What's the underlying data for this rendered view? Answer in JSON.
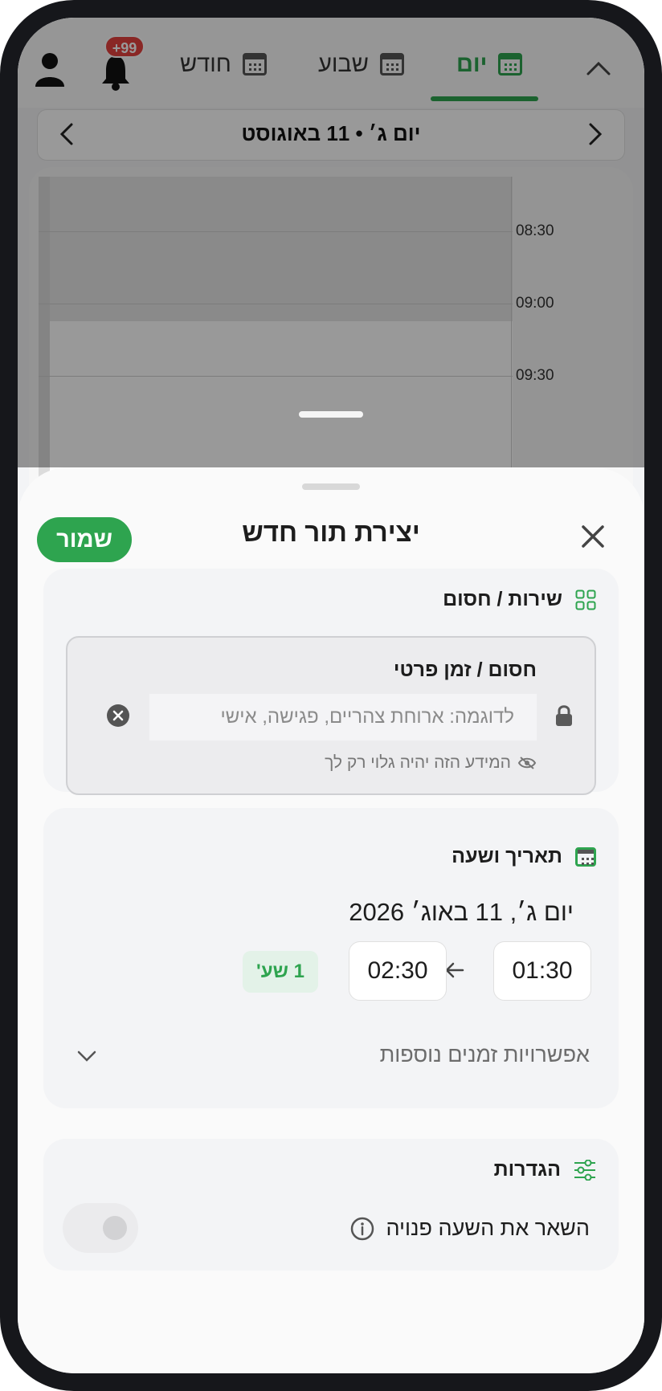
{
  "nav": {
    "tabs": [
      {
        "label": "יום",
        "active": true
      },
      {
        "label": "שבוע",
        "active": false
      },
      {
        "label": "חודש",
        "active": false
      }
    ],
    "notification_badge": "+99"
  },
  "day_header": {
    "title": "יום ג׳ • 11 באוגוסט"
  },
  "calendar": {
    "times": [
      "08:30",
      "09:00",
      "09:30"
    ]
  },
  "sheet": {
    "title": "יצירת תור חדש",
    "save_label": "שמור",
    "service_section": {
      "heading": "שירות / חסום",
      "block_title": "חסום / זמן פרטי",
      "input_placeholder": "לדוגמה: ארוחת צהריים, פגישה, אישי",
      "privacy_note": "המידע הזה יהיה גלוי רק לך"
    },
    "datetime_section": {
      "heading": "תאריך ושעה",
      "date": "יום ג׳, 11 באוג׳ 2026",
      "start_time": "01:30",
      "end_time": "02:30",
      "duration": "1 שע'",
      "more_times": "אפשרויות זמנים נוספות"
    },
    "settings_section": {
      "heading": "הגדרות",
      "keep_free_label": "השאר את השעה פנויה"
    }
  },
  "colors": {
    "accent": "#2ea44f",
    "badge": "#e5413f"
  }
}
